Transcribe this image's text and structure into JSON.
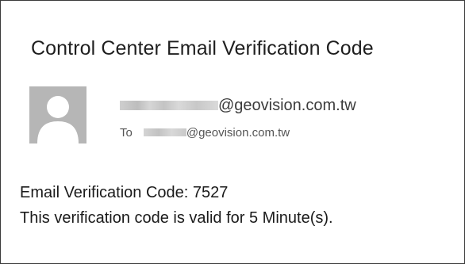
{
  "email": {
    "subject": "Control Center Email Verification Code",
    "sender": {
      "domain": "@geovision.com.tw"
    },
    "recipient": {
      "to_label": "To",
      "domain": "@geovision.com.tw"
    },
    "body": {
      "code_line": "Email Verification Code: 7527",
      "validity_line": "This verification code is valid for 5 Minute(s)."
    },
    "avatar_icon": "person-silhouette-icon"
  },
  "colors": {
    "avatar_background": "#b6b6b6",
    "avatar_silhouette": "#ffffff",
    "border": "#3a3a3a",
    "text": "#1a1a1a"
  }
}
